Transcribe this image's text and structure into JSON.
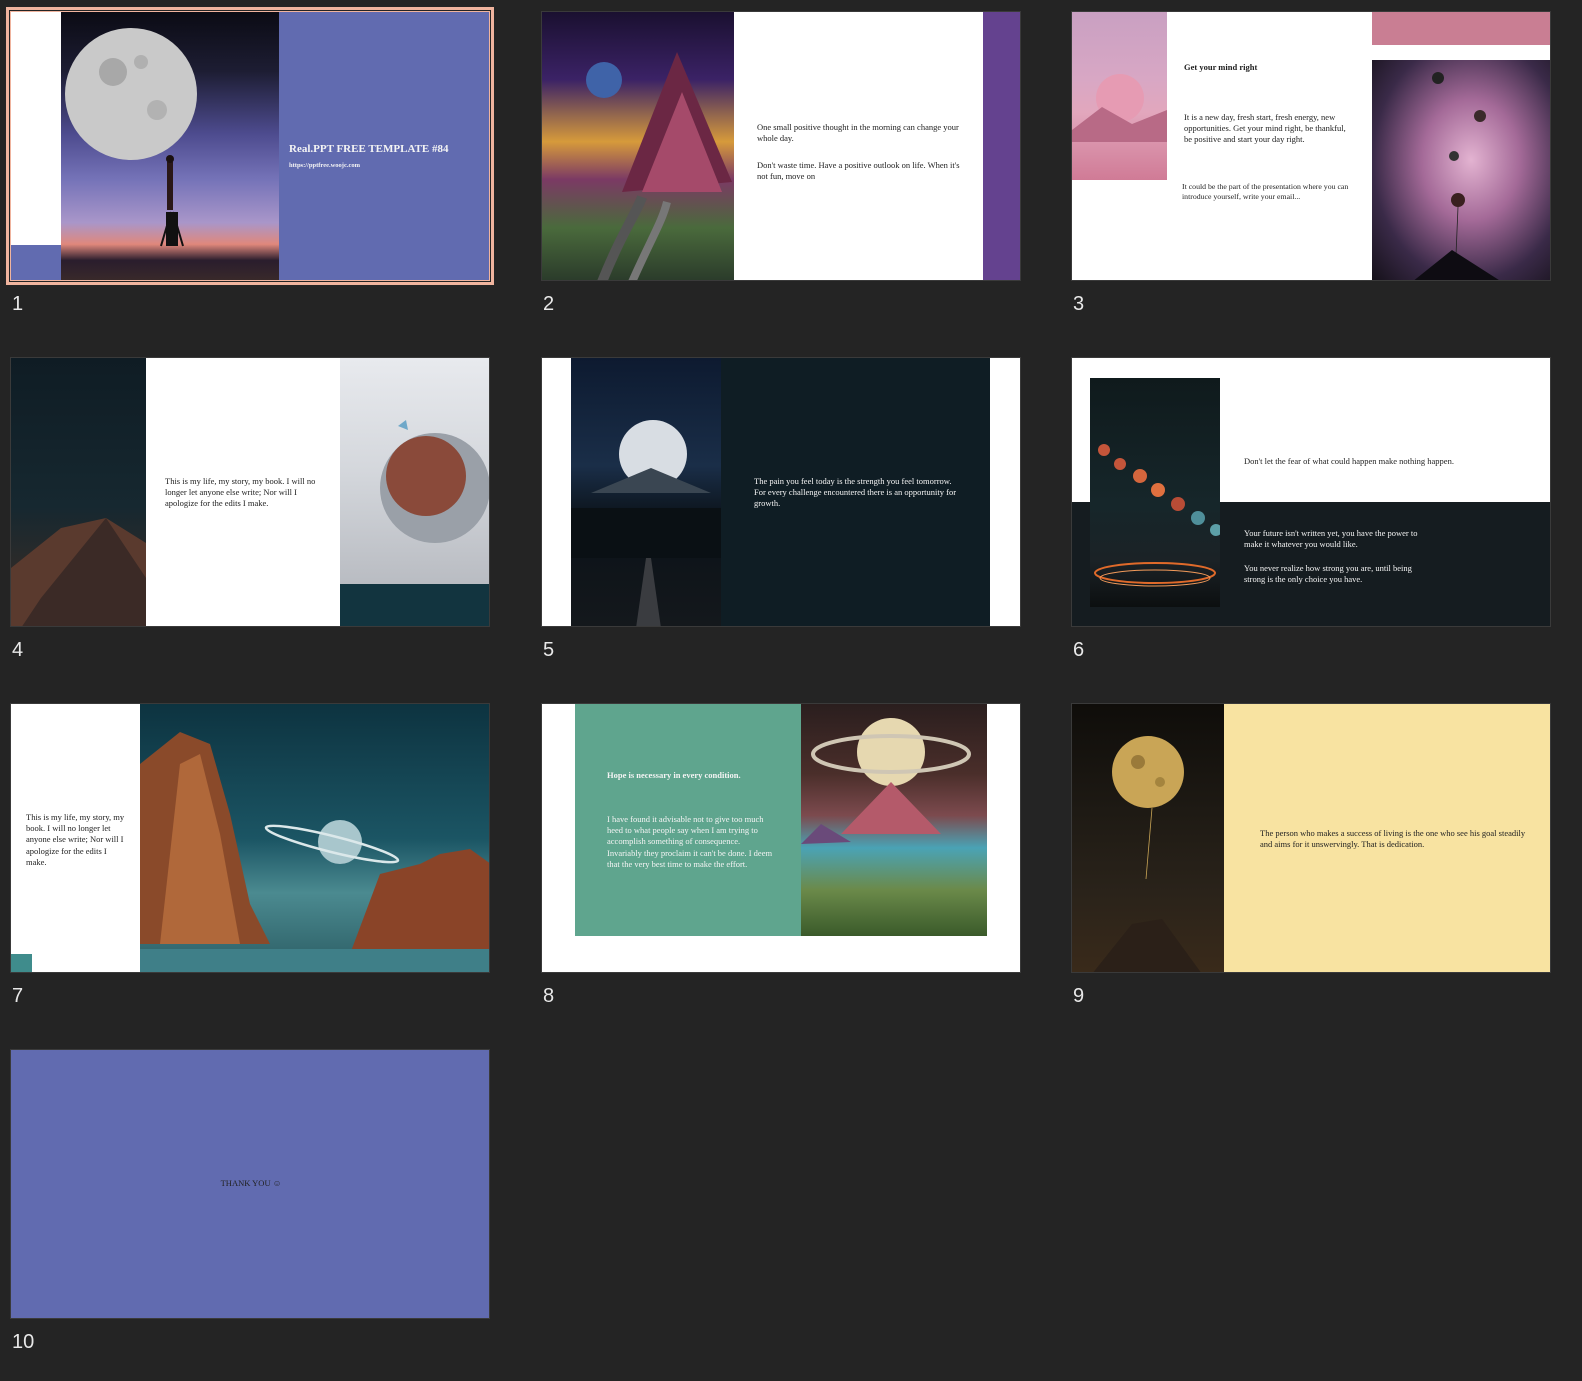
{
  "colors": {
    "background": "#242424",
    "selection": "#f0b49e",
    "periwinkle": "#616bb0",
    "purple": "#64428f",
    "rose": "#c97e93",
    "dark_teal": "#12343f",
    "dark_navy": "#0f1d24",
    "teal_green": "#5fa58e",
    "pale_yellow": "#f8e3a1",
    "teal_square": "#3f8c8c"
  },
  "slides": [
    {
      "number": "1",
      "title": "Real.PPT FREE TEMPLATE #84",
      "url": "https://pptfree.woojc.com",
      "image": "moon-ladder-image"
    },
    {
      "number": "2",
      "text1": "One small positive thought in the morning can change your whole day.",
      "text2": "Don't waste time. Have a positive outlook on life. When it's not fun, move on",
      "image": "mountain-clouds-image"
    },
    {
      "number": "3",
      "heading": "Get your mind right",
      "text1": "It is a new day, fresh start, fresh energy, new opportunities. Get your mind right, be thankful, be positive and start your day right.",
      "text2": "It could be the part of the presentation where you can introduce yourself, write your email...",
      "image_left": "pink-desert-image",
      "image_right": "balloon-planets-image"
    },
    {
      "number": "4",
      "text": "This is my life, my story, my book. I will no longer let anyone else write; Nor will I apologize for the edits I make.",
      "image_left": "starry-mountain-image",
      "image_right": "astronaut-butterfly-image"
    },
    {
      "number": "5",
      "text": "The pain you feel today is the strength you feel tomorrow. For every challenge encountered there is an opportunity for growth.",
      "image": "moon-road-image"
    },
    {
      "number": "6",
      "text1": "Don't let the fear of what could happen make nothing happen.",
      "text2": "Your future isn't written yet, you have the power to make it whatever you would like.",
      "text3": "You never realize how strong you are, until being strong is the only choice you have.",
      "image": "lunar-phases-image"
    },
    {
      "number": "7",
      "text": "This is my life, my story, my book. I will no longer let anyone else write; Nor will I apologize for the edits I make.",
      "image": "canyon-saturn-image"
    },
    {
      "number": "8",
      "heading": "Hope is necessary in every condition.",
      "text": "I have found it advisable not to give too much heed to what people say when I am trying to accomplish something of consequence. Invariably they proclaim it can't be done. I deem that the very best time to make the effort.",
      "image": "saturn-beach-image"
    },
    {
      "number": "9",
      "text": "The person who makes a success of living is the one who see his goal steadily and aims for it unswervingly. That is dedication.",
      "image": "golden-moon-image"
    },
    {
      "number": "10",
      "text": "THANK YOU ☺"
    }
  ]
}
